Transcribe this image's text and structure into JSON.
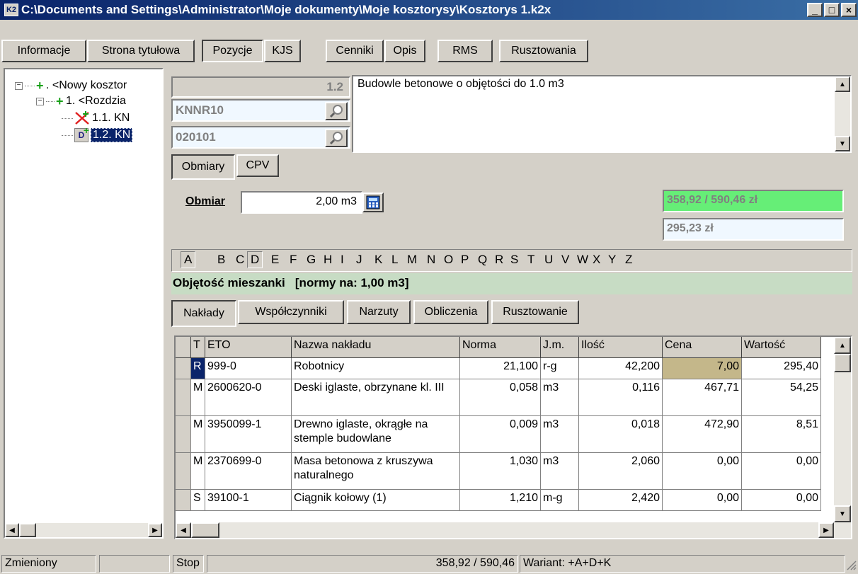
{
  "window": {
    "app_icon_text": "K2",
    "title": "C:\\Documents and Settings\\Administrator\\Moje dokumenty\\Moje kosztorysy\\Kosztorys 1.k2x",
    "minimize": "_",
    "maximize": "□",
    "close": "×"
  },
  "tabs": [
    "Informacje",
    "Strona tytułowa",
    "Pozycje",
    "KJS",
    "Cenniki",
    "Opis",
    "RMS",
    "Rusztowania"
  ],
  "active_tab": "Pozycje",
  "tree": {
    "items": [
      {
        "label": ". <Nowy kosztor",
        "icon": "plus-icon"
      },
      {
        "label": "1. <Rozdzia",
        "icon": "plus-icon"
      },
      {
        "label": "1.1. KN",
        "icon": "red-x-icon"
      },
      {
        "label": "1.2. KN",
        "icon": "d-plus-icon"
      }
    ]
  },
  "position": {
    "number": "1.2",
    "catalog": "KNNR10",
    "code": "020101",
    "description": "Budowle betonowe o objętości do 1.0 m3"
  },
  "subtabs": [
    "Obmiary",
    "CPV"
  ],
  "obmiar": {
    "label": "Obmiar",
    "value": "2,00 m3"
  },
  "totals": {
    "primary": "358,92 / 590,46 zł",
    "secondary": "295,23 zł",
    "primary_color": "#66ee77",
    "secondary_color": "#f0f8ff"
  },
  "alphabet": [
    "A",
    "B",
    "C",
    "D",
    "E",
    "F",
    "G",
    "H",
    "I",
    "J",
    "K",
    "L",
    "M",
    "N",
    "O",
    "P",
    "Q",
    "R",
    "S",
    "T",
    "U",
    "V",
    "W",
    "X",
    "Y",
    "Z"
  ],
  "variant_info": "Objętość mieszanki   [normy na: 1,00 m3]",
  "lower_tabs": [
    "Nakłady",
    "Współczynniki",
    "Narzuty",
    "Obliczenia",
    "Rusztowanie"
  ],
  "grid": {
    "headers": [
      "T",
      "ETO",
      "Nazwa nakładu",
      "Norma",
      "J.m.",
      "Ilość",
      "Cena",
      "Wartość"
    ],
    "rows": [
      {
        "t": "R",
        "eto": "999-0",
        "name": "Robotnicy",
        "norma": "21,100",
        "jm": "r-g",
        "ilosc": "42,200",
        "cena": "7,00",
        "wartosc": "295,40"
      },
      {
        "t": "M",
        "eto": "2600620-0",
        "name": "Deski iglaste, obrzynane kl. III",
        "norma": "0,058",
        "jm": "m3",
        "ilosc": "0,116",
        "cena": "467,71",
        "wartosc": "54,25"
      },
      {
        "t": "M",
        "eto": "3950099-1",
        "name": "Drewno iglaste, okrągłe na stemple budowlane",
        "norma": "0,009",
        "jm": "m3",
        "ilosc": "0,018",
        "cena": "472,90",
        "wartosc": "8,51"
      },
      {
        "t": "M",
        "eto": "2370699-0",
        "name": "Masa betonowa z kruszywa naturalnego",
        "norma": "1,030",
        "jm": "m3",
        "ilosc": "2,060",
        "cena": "0,00",
        "wartosc": "0,00"
      },
      {
        "t": "S",
        "eto": "39100-1",
        "name": "Ciągnik kołowy (1)",
        "norma": "1,210",
        "jm": "m-g",
        "ilosc": "2,420",
        "cena": "0,00",
        "wartosc": "0,00"
      }
    ]
  },
  "status": {
    "state": "Zmieniony",
    "stop": "Stop",
    "summary": "358,92 / 590,46",
    "variant": "Wariant: +A+D+K"
  }
}
